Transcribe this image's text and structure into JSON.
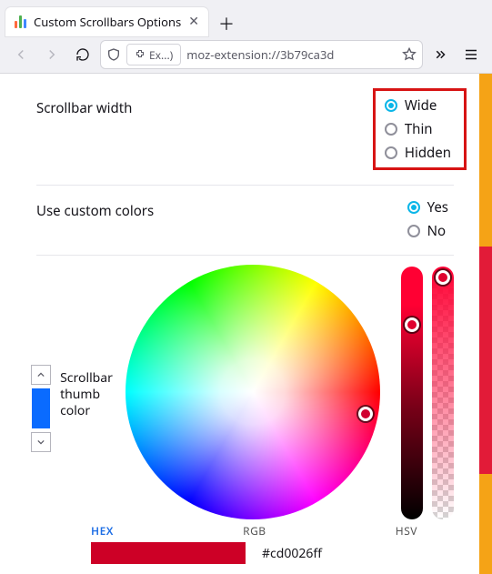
{
  "browser": {
    "tab_title": "Custom Scrollbars Options",
    "ext_chip": "Ex...)",
    "url": "moz-extension://3b79ca3d"
  },
  "page": {
    "width_section": {
      "label": "Scrollbar width",
      "options": [
        {
          "label": "Wide",
          "checked": true
        },
        {
          "label": "Thin",
          "checked": false
        },
        {
          "label": "Hidden",
          "checked": false
        }
      ]
    },
    "colors_section": {
      "label": "Use custom colors",
      "options": [
        {
          "label": "Yes",
          "checked": true
        },
        {
          "label": "No",
          "checked": false
        }
      ]
    },
    "picker": {
      "label_line1": "Scrollbar",
      "label_line2": "thumb",
      "label_line3": "color",
      "swatch_color": "#0a6bff",
      "hex_tab": "HEX",
      "rgb_tab": "RGB",
      "hsv_tab": "HSV",
      "hex_value": "#cd0026ff"
    },
    "scrollbar": {
      "track_color": "#f5a316",
      "thumb_color": "#e21b38"
    }
  }
}
